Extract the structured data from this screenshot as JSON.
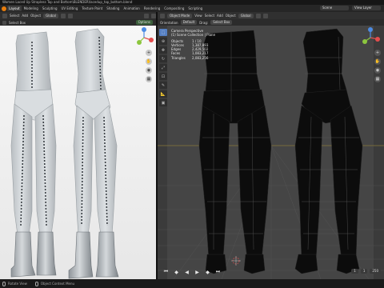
{
  "window": {
    "title": "Women Laced Up Strapless Top and Bottom\\BLENDER\\lacedup_top_bottom.blend"
  },
  "menu": {
    "items": [
      "Layout",
      "Modeling",
      "Sculpting",
      "UV Editing",
      "Texture Paint",
      "Shading",
      "Animation",
      "Rendering",
      "Compositing",
      "Scripting"
    ],
    "active_index": 0,
    "scene": "Scene",
    "view_layer": "View Layer"
  },
  "left_viewport": {
    "header": {
      "select_label": "Select",
      "add_label": "Add",
      "object_label": "Object",
      "transform": "Global",
      "options_label": "Options"
    },
    "sub_header": {
      "select_box": "Select Box"
    },
    "background_color": "#f2f2f2",
    "garment_color": "#cfd4d8",
    "lace_color": "#3a3f44"
  },
  "right_viewport": {
    "header": {
      "mode": "Object Mode",
      "view_label": "View",
      "select_label": "Select",
      "add_label": "Add",
      "object_label": "Object",
      "transform": "Global"
    },
    "sub_header": {
      "orientation": "Orientation",
      "default": "Default",
      "drag": "Drag:",
      "select_box": "Select Box"
    },
    "stats": {
      "view_name": "Camera Perspective",
      "collection": "(1) Scene Collection | Plane",
      "rows": [
        {
          "key": "Objects",
          "value": "1 / 10"
        },
        {
          "key": "Vertices",
          "value": "1,387,893"
        },
        {
          "key": "Edges",
          "value": "2,429,502"
        },
        {
          "key": "Faces",
          "value": "1,083,217"
        },
        {
          "key": "Triangles",
          "value": "2,083,256"
        }
      ]
    },
    "background_color": "#3b3b3b",
    "wire_color": "#0c0c0c"
  },
  "timeline": {
    "frame_start": "1",
    "frame_end": "250",
    "current_frame": "1"
  },
  "status_bar": {
    "left_item": "Rotate View",
    "middle_item": "Object Context Menu"
  },
  "icons": {
    "play": "play-icon",
    "gizmo": "navigation-gizmo-icon"
  },
  "colors": {
    "accent": "#5680c2",
    "axis_x": "#e44d4d",
    "axis_y": "#8cc63e",
    "axis_z": "#4d8ce4"
  }
}
